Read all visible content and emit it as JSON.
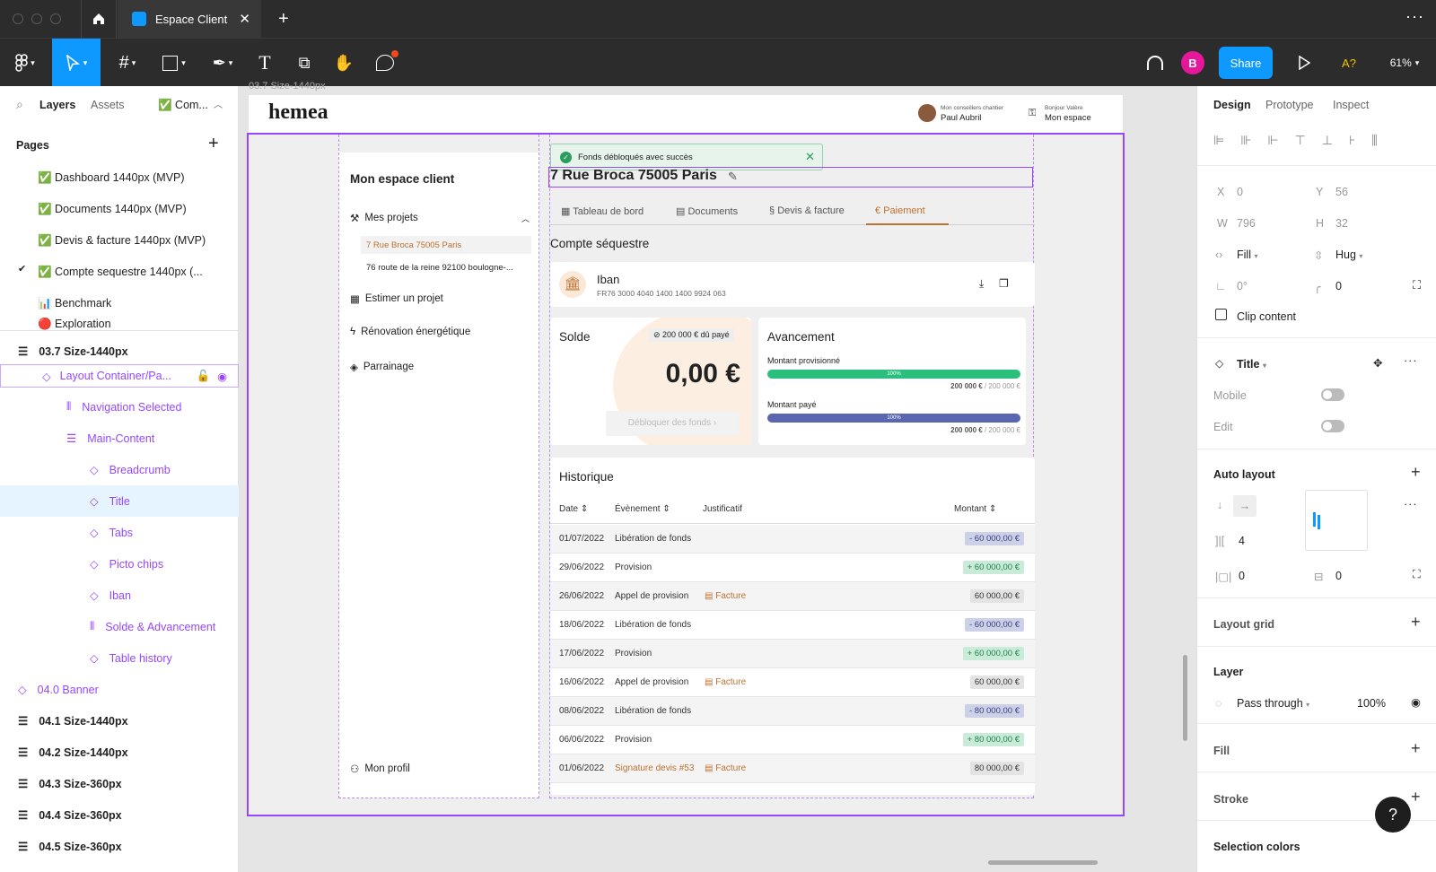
{
  "window": {
    "tab_title": "Espace Client"
  },
  "toolbar": {
    "avatar_letter": "B",
    "share_label": "Share",
    "autosave": "A?",
    "zoom": "61%"
  },
  "left_panel": {
    "tabs": {
      "layers": "Layers",
      "assets": "Assets",
      "current": "✅ Com..."
    },
    "pages_title": "Pages",
    "pages": [
      "✅ Dashboard 1440px (MVP)",
      "✅ Documents 1440px (MVP)",
      "✅ Devis & facture 1440px (MVP)",
      "✅ Compte sequestre 1440px (...",
      "📊 Benchmark",
      "🔴 Exploration"
    ],
    "layers": {
      "frame": "03.7 Size-1440px",
      "layout_container": "Layout Container/Pa...",
      "navigation": "Navigation Selected",
      "main_content": "Main-Content",
      "breadcrumb": "Breadcrumb",
      "title": "Title",
      "tabs": "Tabs",
      "picto_chips": "Picto chips",
      "iban": "Iban",
      "solde": "Solde & Advancement",
      "table": "Table history",
      "banner": "04.0 Banner",
      "f041": "04.1 Size-1440px",
      "f042": "04.2 Size-1440px",
      "f043": "04.3 Size-360px",
      "f044": "04.4 Size-360px",
      "f045": "04.5 Size-360px"
    }
  },
  "canvas": {
    "frame_label": "03.7 Size-1440px",
    "header": {
      "logo": "hemea",
      "advisor_caption": "Mon conseillers chantier",
      "advisor_name": "Paul Aubril",
      "user_caption": "Bonjour Valère",
      "user_space": "Mon espace"
    },
    "sidebar": {
      "title": "Mon espace client",
      "projects": "Mes projets",
      "project_items": [
        "7 Rue Broca 75005 Paris",
        "76 route de la reine 92100 boulogne-..."
      ],
      "estimate": "Estimer un projet",
      "renovation": "Rénovation énergétique",
      "referral": "Parrainage",
      "profile": "Mon profil"
    },
    "toast": "Fonds débloqués avec succès",
    "title": "7 Rue Broca 75005 Paris",
    "tabs": [
      "Tableau de bord",
      "Documents",
      "Devis & facture",
      "Paiement"
    ],
    "section_title": "Compte séquestre",
    "iban": {
      "label": "Iban",
      "number": "FR76 3000 4040 1400 1400 9924 063"
    },
    "solde": {
      "label": "Solde",
      "chip": "200 000 € dû payé",
      "amount": "0,00 €",
      "button": "Débloquer des fonds"
    },
    "avancement": {
      "title": "Avancement",
      "prov_label": "Montant provisionné",
      "prov_pct": "100%",
      "prov_amount": "200 000 €",
      "prov_total": " / 200 000 €",
      "paid_label": "Montant payé",
      "paid_pct": "100%",
      "paid_amount": "200 000 €",
      "paid_total": " / 200 000 €"
    },
    "history": {
      "title": "Historique",
      "headers": {
        "date": "Date",
        "event": "Évènement",
        "doc": "Justificatif",
        "amount": "Montant"
      },
      "rows": [
        {
          "date": "01/07/2022",
          "event": "Libération de fonds",
          "doc": "",
          "amount": "- 60 000,00 €",
          "kind": "neg"
        },
        {
          "date": "29/06/2022",
          "event": "Provision",
          "doc": "",
          "amount": "+ 60 000,00 €",
          "kind": "pos"
        },
        {
          "date": "26/06/2022",
          "event": "Appel de provision",
          "doc": "Facture",
          "amount": "60 000,00 €",
          "kind": "neu"
        },
        {
          "date": "18/06/2022",
          "event": "Libération de fonds",
          "doc": "",
          "amount": "- 60 000,00 €",
          "kind": "neg"
        },
        {
          "date": "17/06/2022",
          "event": "Provision",
          "doc": "",
          "amount": "+ 60 000,00 €",
          "kind": "pos"
        },
        {
          "date": "16/06/2022",
          "event": "Appel de provision",
          "doc": "Facture",
          "amount": "60 000,00 €",
          "kind": "neu"
        },
        {
          "date": "08/06/2022",
          "event": "Libération de fonds",
          "doc": "",
          "amount": "- 80 000,00 €",
          "kind": "neg"
        },
        {
          "date": "06/06/2022",
          "event": "Provision",
          "doc": "",
          "amount": "+ 80 000,00 €",
          "kind": "pos"
        },
        {
          "date": "01/06/2022",
          "event": "Signature devis #53",
          "doc": "Facture",
          "amount": "80 000,00 €",
          "kind": "neu"
        }
      ]
    }
  },
  "right_panel": {
    "tabs": [
      "Design",
      "Prototype",
      "Inspect"
    ],
    "x": "0",
    "y": "56",
    "w": "796",
    "h": "32",
    "fill": "Fill",
    "hug": "Hug",
    "rotation": "0°",
    "radius": "0",
    "clip": "Clip content",
    "component": "Title",
    "mobile": "Mobile",
    "edit": "Edit",
    "auto_layout": "Auto layout",
    "gap": "4",
    "pad_h": "0",
    "pad_v": "0",
    "layout_grid": "Layout grid",
    "layer": "Layer",
    "blend": "Pass through",
    "opacity": "100%",
    "fill_title": "Fill",
    "stroke": "Stroke",
    "selection_colors": "Selection colors",
    "help": "?"
  },
  "colors": {
    "accent": "#0d99ff",
    "purple": "#9747ff",
    "brand": "#c0702f",
    "green": "#2bbf7e",
    "indigo": "#5a66b0"
  }
}
